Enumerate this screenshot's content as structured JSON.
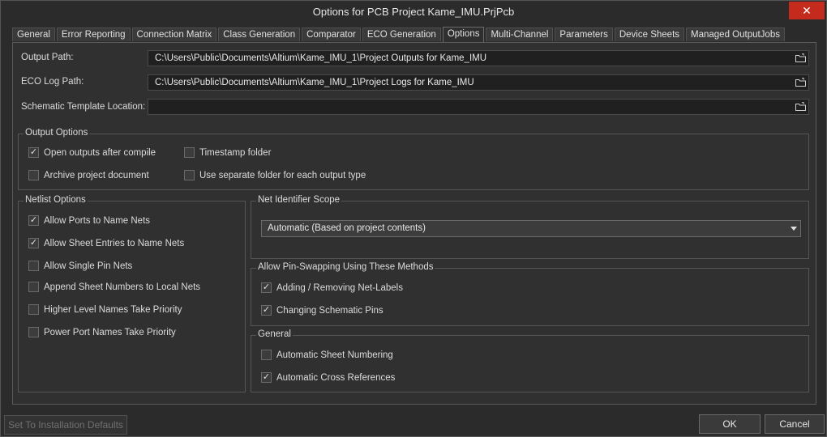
{
  "window": {
    "title": "Options for PCB Project Kame_IMU.PrjPcb",
    "close_glyph": "✕"
  },
  "tabs": [
    {
      "label": "General"
    },
    {
      "label": "Error Reporting"
    },
    {
      "label": "Connection Matrix"
    },
    {
      "label": "Class Generation"
    },
    {
      "label": "Comparator"
    },
    {
      "label": "ECO Generation"
    },
    {
      "label": "Options",
      "active": true
    },
    {
      "label": "Multi-Channel"
    },
    {
      "label": "Parameters"
    },
    {
      "label": "Device Sheets"
    },
    {
      "label": "Managed OutputJobs"
    }
  ],
  "paths": {
    "output_label": "Output Path:",
    "output_value": "C:\\Users\\Public\\Documents\\Altium\\Kame_IMU_1\\Project Outputs for Kame_IMU",
    "eco_label": "ECO Log Path:",
    "eco_value": "C:\\Users\\Public\\Documents\\Altium\\Kame_IMU_1\\Project Logs for Kame_IMU",
    "template_label": "Schematic Template Location:",
    "template_value": ""
  },
  "output_options": {
    "title": "Output Options",
    "items": [
      {
        "label": "Open outputs after compile",
        "checked": true
      },
      {
        "label": "Timestamp folder",
        "checked": false
      },
      {
        "label": "Archive project document",
        "checked": false
      },
      {
        "label": "Use separate folder for each output type",
        "checked": false
      }
    ]
  },
  "netlist_options": {
    "title": "Netlist Options",
    "items": [
      {
        "label": "Allow Ports to Name Nets",
        "checked": true
      },
      {
        "label": "Allow Sheet Entries to Name Nets",
        "checked": true
      },
      {
        "label": "Allow Single Pin Nets",
        "checked": false
      },
      {
        "label": "Append Sheet Numbers to Local Nets",
        "checked": false
      },
      {
        "label": "Higher Level Names Take Priority",
        "checked": false
      },
      {
        "label": "Power Port Names Take Priority",
        "checked": false
      }
    ]
  },
  "net_identifier_scope": {
    "title": "Net Identifier Scope",
    "selected": "Automatic (Based on project contents)"
  },
  "pin_swapping": {
    "title": "Allow Pin-Swapping Using These Methods",
    "items": [
      {
        "label": "Adding / Removing Net-Labels",
        "checked": true
      },
      {
        "label": "Changing Schematic Pins",
        "checked": true
      }
    ]
  },
  "general": {
    "title": "General",
    "items": [
      {
        "label": "Automatic Sheet Numbering",
        "checked": false
      },
      {
        "label": "Automatic Cross References",
        "checked": true
      }
    ]
  },
  "footer": {
    "defaults_label": "Set To Installation Defaults",
    "ok_label": "OK",
    "cancel_label": "Cancel"
  },
  "check_glyph": "✓"
}
